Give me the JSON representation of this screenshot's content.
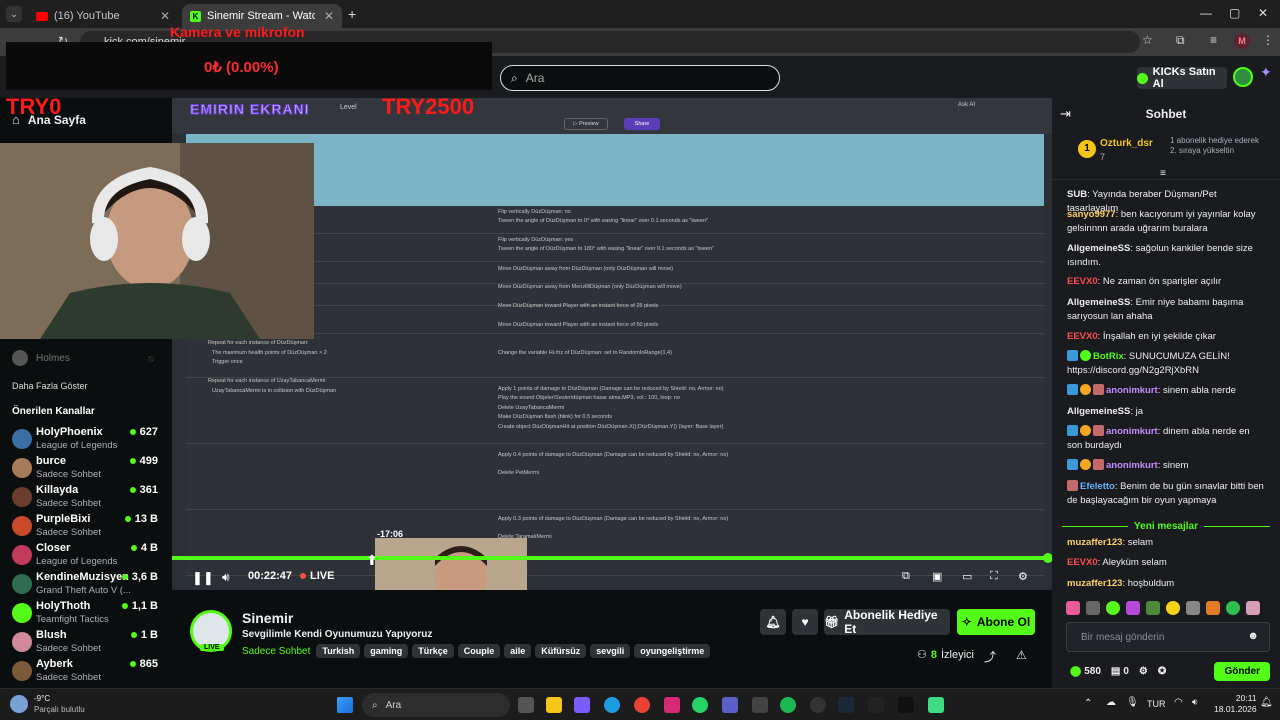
{
  "browser": {
    "tabs": [
      {
        "label": "(16) YouTube"
      },
      {
        "label": "Sinemir Stream - Watch Live"
      }
    ],
    "url": "kick.com/sinemir",
    "profile_initial": "M"
  },
  "header": {
    "search_placeholder": "Ara",
    "kicks_label": "KICKs Satın Al"
  },
  "overlay": {
    "camera_label": "Kamera ve mikrofon",
    "donation": "0₺ (0.00%)",
    "try0": "TRY0",
    "try2500": "TRY2500",
    "screen_label": "EMIRIN EKRANI"
  },
  "sidebar": {
    "home": "Ana Sayfa",
    "followed_user": "Holmes",
    "show_more": "Daha Fazla Göster",
    "recommended_title": "Önerilen Kanallar",
    "channels": [
      {
        "name": "HolyPhoenix",
        "game": "League of Legends",
        "viewers": "627",
        "color": "#3a6ea5"
      },
      {
        "name": "burce",
        "game": "Sadece Sohbet",
        "viewers": "499",
        "color": "#a57b5a"
      },
      {
        "name": "Killayda",
        "game": "Sadece Sohbet",
        "viewers": "361",
        "color": "#6b3d2e"
      },
      {
        "name": "PurpleBixi",
        "game": "Sadece Sohbet",
        "viewers": "13 B",
        "color": "#c94a2a"
      },
      {
        "name": "Closer",
        "game": "League of Legends",
        "viewers": "4 B",
        "color": "#c23b5a"
      },
      {
        "name": "KendineMuzisyen",
        "game": "Grand Theft Auto V (...",
        "viewers": "3,6 B",
        "color": "#2f6d4f"
      },
      {
        "name": "HolyThoth",
        "game": "Teamfight Tactics",
        "viewers": "1,1 B",
        "color": "#53fc18"
      },
      {
        "name": "Blush",
        "game": "Sadece Sohbet",
        "viewers": "1 B",
        "color": "#d08a9a"
      },
      {
        "name": "Ayberk",
        "game": "Sadece Sohbet",
        "viewers": "865",
        "color": "#7a5a3a"
      }
    ]
  },
  "player": {
    "editor_level": "Level",
    "preview": "Preview",
    "share": "Share",
    "ask_ai": "Ask AI",
    "seek_preview": "-17:06",
    "time": "00:22:47",
    "live": "LIVE",
    "progress": 1.0,
    "event_texts": [
      "Flip vertically  DüzDüşman: no",
      "Tween the angle of DüzDüşman to 0° with easing \"linear\" over 0.1 seconds as \"tween\"",
      "Flip vertically  DüzDüşman: yes",
      "Tween the angle of DüzDüşman to 180° with easing \"linear\" over 0.1 seconds as \"tween\"",
      "Move DüzDüşman away from DüzDüşman (only DüzDüşman will move)",
      "Move DüzDüşman away from MenzilliDüşman (only DüzDüşman will move)",
      "Move DüzDüşman toward Player with an instant force of 25 pixels",
      "Move DüzDüşman toward Player with an instant force of 50 pixels",
      "Repeat for each instance of DüzDüşman:",
      "The maximum health points of DüzDüşman > 2",
      "Trigger once",
      "Change the variable Hi.rhz of DüzDüşman: set to RandomInRange(1,4)",
      "Repeat for each instance of UzayTabancaMermi:",
      "UzayTabancaMermi is in collision with DüzDüşman",
      "Apply 1 points of damage to DüzDüşman (Damage can be reduced by Shield: no, Armor: no)",
      "Play the sound Objeler\\Sesler\\düşman hasar alma.MP3, vol.: 100, loop: no",
      "Delete UzayTabancaMermi",
      "Make DüzDüşman flash (blink) for 0.5 seconds",
      "Create object DüzDüşmanHit at position DüzDüşman.X();DüzDüşman.Y() (layer: Base layer)",
      "Apply 0.4 points of damage to DüzDüşman (Damage can be reduced by Shield: no, Armor: no)",
      "Delete PetMermi",
      "Apply 0.3 points of damage to DüzDüşman (Damage can be reduced by Shield: no, Armor: no)",
      "Delete TaramalıMermi"
    ]
  },
  "stream": {
    "channel": "Sinemir",
    "title": "Sevgilimle Kendi Oyunumuzu Yapıyoruz",
    "category": "Sadece Sohbet",
    "tags": [
      "Turkish",
      "gaming",
      "Türkçe",
      "Couple",
      "aile",
      "Küfürsüz",
      "sevgili",
      "oyungeliştirme"
    ],
    "live_badge": "LIVE",
    "gift_sub": "Abonelik Hediye Et",
    "subscribe": "Abone Ol",
    "viewers": "8",
    "viewers_label": "İzleyici"
  },
  "chat": {
    "title": "Sohbet",
    "pinned_user": "Ozturk_dsr",
    "pinned_count": "7",
    "pinned_rank": "1",
    "pinned_note": "1 abonelik hediye ederek 2. sıraya yükseltin",
    "messages": [
      {
        "user": "SUB",
        "text": "Yayında beraber Düşman/Pet tasarlayalım",
        "color": "#efeff1"
      },
      {
        "user": "sanyo9977",
        "text": "ben kacıyorum iyi yayınlar kolay gelsinnnn arada uğrarım buralara",
        "color": "#ffd166"
      },
      {
        "user": "AllgemeineSS",
        "text": "sağolun kankiler bende size ısındım.",
        "color": "#ffffff"
      },
      {
        "user": "EEVX0",
        "text": "Ne zaman ön sparişler açılır",
        "color": "#ff4d4d"
      },
      {
        "user": "AllgemeineSS",
        "text": "Emir niye babamı başıma sarıyosun lan ahaha",
        "color": "#ffffff"
      },
      {
        "user": "EEVX0",
        "text": "İnşallah en iyi şekilde çıkar",
        "color": "#ff4d4d"
      },
      {
        "user": "BotRix",
        "text": "SUNUCUMUZA GELİN! https://discord.gg/N2g2RjXbRN",
        "color": "#53fc18"
      },
      {
        "user": "anonimkurt",
        "text": "sinem abla nerde",
        "color": "#c58cff"
      },
      {
        "user": "AllgemeineSS",
        "text": "ja",
        "color": "#ffffff"
      },
      {
        "user": "anonimkurt",
        "text": "dinem abla nerde en son burdaydı",
        "color": "#c58cff"
      },
      {
        "user": "anonimkurt",
        "text": "sinem",
        "color": "#c58cff"
      },
      {
        "user": "Efeletto",
        "text": "Benim de bu gün sınavlar bitti ben de başlayacağım bir oyun yapmaya",
        "color": "#66b3ff"
      }
    ],
    "new_messages": "Yeni mesajlar",
    "recent": [
      {
        "user": "muzaffer123",
        "text": "selam",
        "color": "#ffd166"
      },
      {
        "user": "EEVX0",
        "text": "Aleyküm selam",
        "color": "#ff4d4d"
      },
      {
        "user": "muzaffer123",
        "text": "hoşbuldum",
        "color": "#ffd166"
      }
    ],
    "input_placeholder": "Bir mesaj gönderin",
    "points": "580",
    "chests": "0",
    "send": "Gönder"
  },
  "taskbar": {
    "temp": "-9°C",
    "weather": "Parçalı bulutlu",
    "search": "Ara",
    "lang": "TUR",
    "time": "20:11",
    "date": "18.01.2026"
  }
}
